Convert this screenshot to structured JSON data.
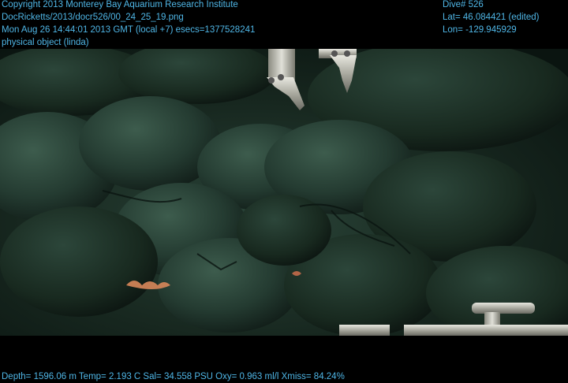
{
  "header_left": {
    "line1": "Copyright 2013 Monterey Bay Aquarium Research Institute",
    "line2": "DocRicketts/2013/docr526/00_24_25_19.png",
    "line3": "Mon Aug 26 14:44:01 2013 GMT (local +7)  esecs=1377528241",
    "line4": "physical object (linda)"
  },
  "header_right": {
    "dive": "Dive# 526",
    "lat": "Lat= 46.084421 (edited)",
    "lon": "Lon= -129.945929"
  },
  "footer": {
    "telemetry": "Depth= 1596.06 m  Temp= 2.193 C  Sal= 34.558 PSU  Oxy= 0.963 ml/l  Xmiss= 84.24%"
  },
  "colors": {
    "overlay_text": "#4fb6e6",
    "background": "#000000",
    "seafloor_dark": "#0e1a16",
    "seafloor_mid": "#223a30",
    "seafloor_light": "#3a5a4a"
  }
}
